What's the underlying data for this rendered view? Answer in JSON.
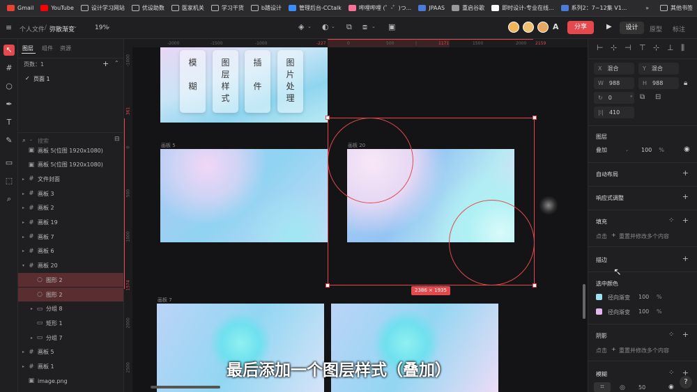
{
  "bookmarks": [
    {
      "label": "Gmail",
      "icon": "gmail-icon",
      "color": "#e94235"
    },
    {
      "label": "YouTube",
      "icon": "youtube-icon",
      "color": "#ff0000"
    },
    {
      "label": "设计学习网站",
      "icon": "folder-icon"
    },
    {
      "label": "优设助数",
      "icon": "folder-icon"
    },
    {
      "label": "医家机关",
      "icon": "folder-icon"
    },
    {
      "label": "学习干货",
      "icon": "folder-icon"
    },
    {
      "label": "b踏设计",
      "icon": "folder-icon"
    },
    {
      "label": "管理后台-CCtalk",
      "icon": "cctalk-icon",
      "color": "#3b8cff"
    },
    {
      "label": "哔哩哔哩 (゜-゜)つ...",
      "icon": "bilibili-icon",
      "color": "#fb7299"
    },
    {
      "label": "JPAAS",
      "icon": "jpaas-icon",
      "color": "#4a7bd9"
    },
    {
      "label": "重启谷歌",
      "icon": "globe-icon",
      "color": "#999999"
    },
    {
      "label": "即时设计-专业在线...",
      "icon": "jsdesign-icon",
      "color": "#ffffff"
    },
    {
      "label": "系列2：7~12集 V1...",
      "icon": "doc-icon",
      "color": "#4a7bd9"
    }
  ],
  "bookmarks_more": "»",
  "bookmarks_other": "其他书签",
  "toolbar": {
    "breadcrumb_root": "个人文件",
    "breadcrumb_sep": "/",
    "file_name": "弥散渐变",
    "zoom": "19%",
    "share": "分享",
    "mode_design": "设计",
    "mode_prototype": "原型",
    "mode_annotate": "标注",
    "accent": "#e5484d"
  },
  "left_panel": {
    "tabs": [
      "图层",
      "组件",
      "资源"
    ],
    "pages_label": "页数：1",
    "page_item": "页面 1",
    "search_placeholder": "搜索",
    "layers": [
      {
        "name": "画板 5(位图 1920x1080)",
        "icon": "image-icon",
        "indent": 0,
        "caret": "",
        "selected": false
      },
      {
        "name": "画板 5(位图 1920x1080)",
        "icon": "image-icon",
        "indent": 0,
        "caret": "",
        "selected": false
      },
      {
        "name": "文件封面",
        "icon": "frame-icon",
        "indent": 0,
        "caret": "▸",
        "selected": false
      },
      {
        "name": "画板 3",
        "icon": "frame-icon",
        "indent": 0,
        "caret": "▸",
        "selected": false
      },
      {
        "name": "画板 2",
        "icon": "frame-icon",
        "indent": 0,
        "caret": "▸",
        "selected": false
      },
      {
        "name": "画板 19",
        "icon": "frame-icon",
        "indent": 0,
        "caret": "▸",
        "selected": false
      },
      {
        "name": "画板 7",
        "icon": "frame-icon",
        "indent": 0,
        "caret": "▸",
        "selected": false
      },
      {
        "name": "画板 6",
        "icon": "frame-icon",
        "indent": 0,
        "caret": "▸",
        "selected": false
      },
      {
        "name": "画板 20",
        "icon": "frame-icon",
        "indent": 0,
        "caret": "▾",
        "selected": false
      },
      {
        "name": "图形 2",
        "icon": "ellipse-icon",
        "indent": 1,
        "caret": "",
        "selected": true
      },
      {
        "name": "图形 2",
        "icon": "ellipse-icon",
        "indent": 1,
        "caret": "",
        "selected": true
      },
      {
        "name": "分组 8",
        "icon": "folder-icon",
        "indent": 1,
        "caret": "▸",
        "selected": false
      },
      {
        "name": "矩形 1",
        "icon": "rect-icon",
        "indent": 1,
        "caret": "",
        "selected": false
      },
      {
        "name": "分组 7",
        "icon": "folder-icon",
        "indent": 1,
        "caret": "▸",
        "selected": false
      },
      {
        "name": "画板 5",
        "icon": "frame-icon",
        "indent": 0,
        "caret": "▸",
        "selected": false
      },
      {
        "name": "画板 1",
        "icon": "frame-icon",
        "indent": 0,
        "caret": "▸",
        "selected": false
      },
      {
        "name": "image.png",
        "icon": "image-icon",
        "indent": 0,
        "caret": "",
        "selected": false
      }
    ]
  },
  "canvas": {
    "ruler_top": [
      "-2000",
      "-1500",
      "-1000",
      "-227",
      "0",
      "500",
      "|",
      "1171",
      "1500",
      "2000",
      "2159"
    ],
    "ruler_left": [
      "-1000",
      "361",
      "0",
      "500",
      "1000",
      "1574",
      "2000",
      "2500"
    ],
    "artboard_labels": [
      "画板 5",
      "画板 20",
      "画板 7"
    ],
    "cards": [
      "模\n\n糊",
      "图\n层\n样\n式",
      "插\n\n件",
      "图\n片\n处\n理"
    ],
    "size_badge": "2386 × 1935",
    "caption": "最后添加一个图层样式（叠加）"
  },
  "right_panel": {
    "x_label": "X",
    "x_value": "混合",
    "y_label": "Y",
    "y_value": "混合",
    "w_label": "W",
    "w_value": "988",
    "h_label": "H",
    "h_value": "988",
    "rotation": "0",
    "rotation_unit": "°",
    "spacing": "410",
    "layer_title": "图层",
    "blend_mode": "叠加",
    "opacity": "100",
    "percent": "%",
    "auto_layout": "自动布局",
    "responsive": "响应式调整",
    "fill_title": "填充",
    "fill_hint": "点击",
    "fill_hint2": "重置并修改多个内容",
    "stroke_title": "描边",
    "selected_colors": "选中颜色",
    "colors": [
      {
        "label": "径向渐变",
        "opacity": "100",
        "color": "#9be3f2"
      },
      {
        "label": "径向渐变",
        "opacity": "100",
        "color": "#e3b7f0"
      }
    ],
    "shadow_title": "阴影",
    "shadow_hint": "点击",
    "shadow_hint2": "重置并修改多个内容",
    "blur_title": "模糊",
    "blur_value": "50",
    "help": "?"
  }
}
